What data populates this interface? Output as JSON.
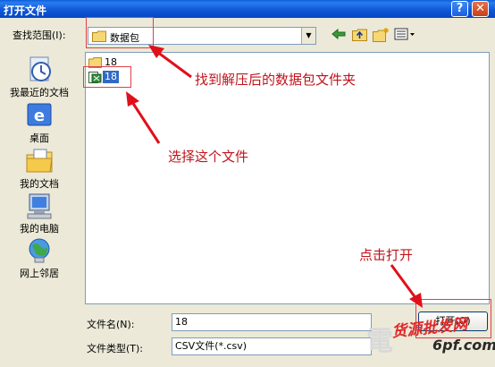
{
  "window": {
    "title": "打开文件",
    "help_label": "?",
    "close_label": "✕"
  },
  "lookin": {
    "label": "查找范围(I):",
    "value": "数据包"
  },
  "toolbar": {
    "back_icon": "back-arrow-icon",
    "up_icon": "up-folder-icon",
    "newfolder_icon": "new-folder-icon",
    "views_icon": "views-menu-icon"
  },
  "places": [
    {
      "label": "我最近的文档",
      "icon": "recent-documents-icon"
    },
    {
      "label": "桌面",
      "icon": "desktop-icon"
    },
    {
      "label": "我的文档",
      "icon": "my-documents-icon"
    },
    {
      "label": "我的电脑",
      "icon": "my-computer-icon"
    },
    {
      "label": "网上邻居",
      "icon": "network-places-icon"
    }
  ],
  "files": [
    {
      "name": "18",
      "type": "folder"
    },
    {
      "name": "18",
      "type": "csv-file",
      "selected": true
    }
  ],
  "filename": {
    "label": "文件名(N):",
    "value": "18"
  },
  "filetype": {
    "label": "文件类型(T):",
    "value": "CSV文件(*.csv)"
  },
  "open_button": {
    "label": "打开(O)"
  },
  "annotations": {
    "find_folder": "找到解压后的数据包文件夹",
    "select_file": "选择这个文件",
    "click_open": "点击打开"
  },
  "colors": {
    "annotation_red": "#c0141c",
    "selection_blue": "#316ac5",
    "titlebar_blue": "#0a5fd8"
  },
  "watermark": {
    "line1": "货源批发网",
    "line2": "6pf.com"
  }
}
